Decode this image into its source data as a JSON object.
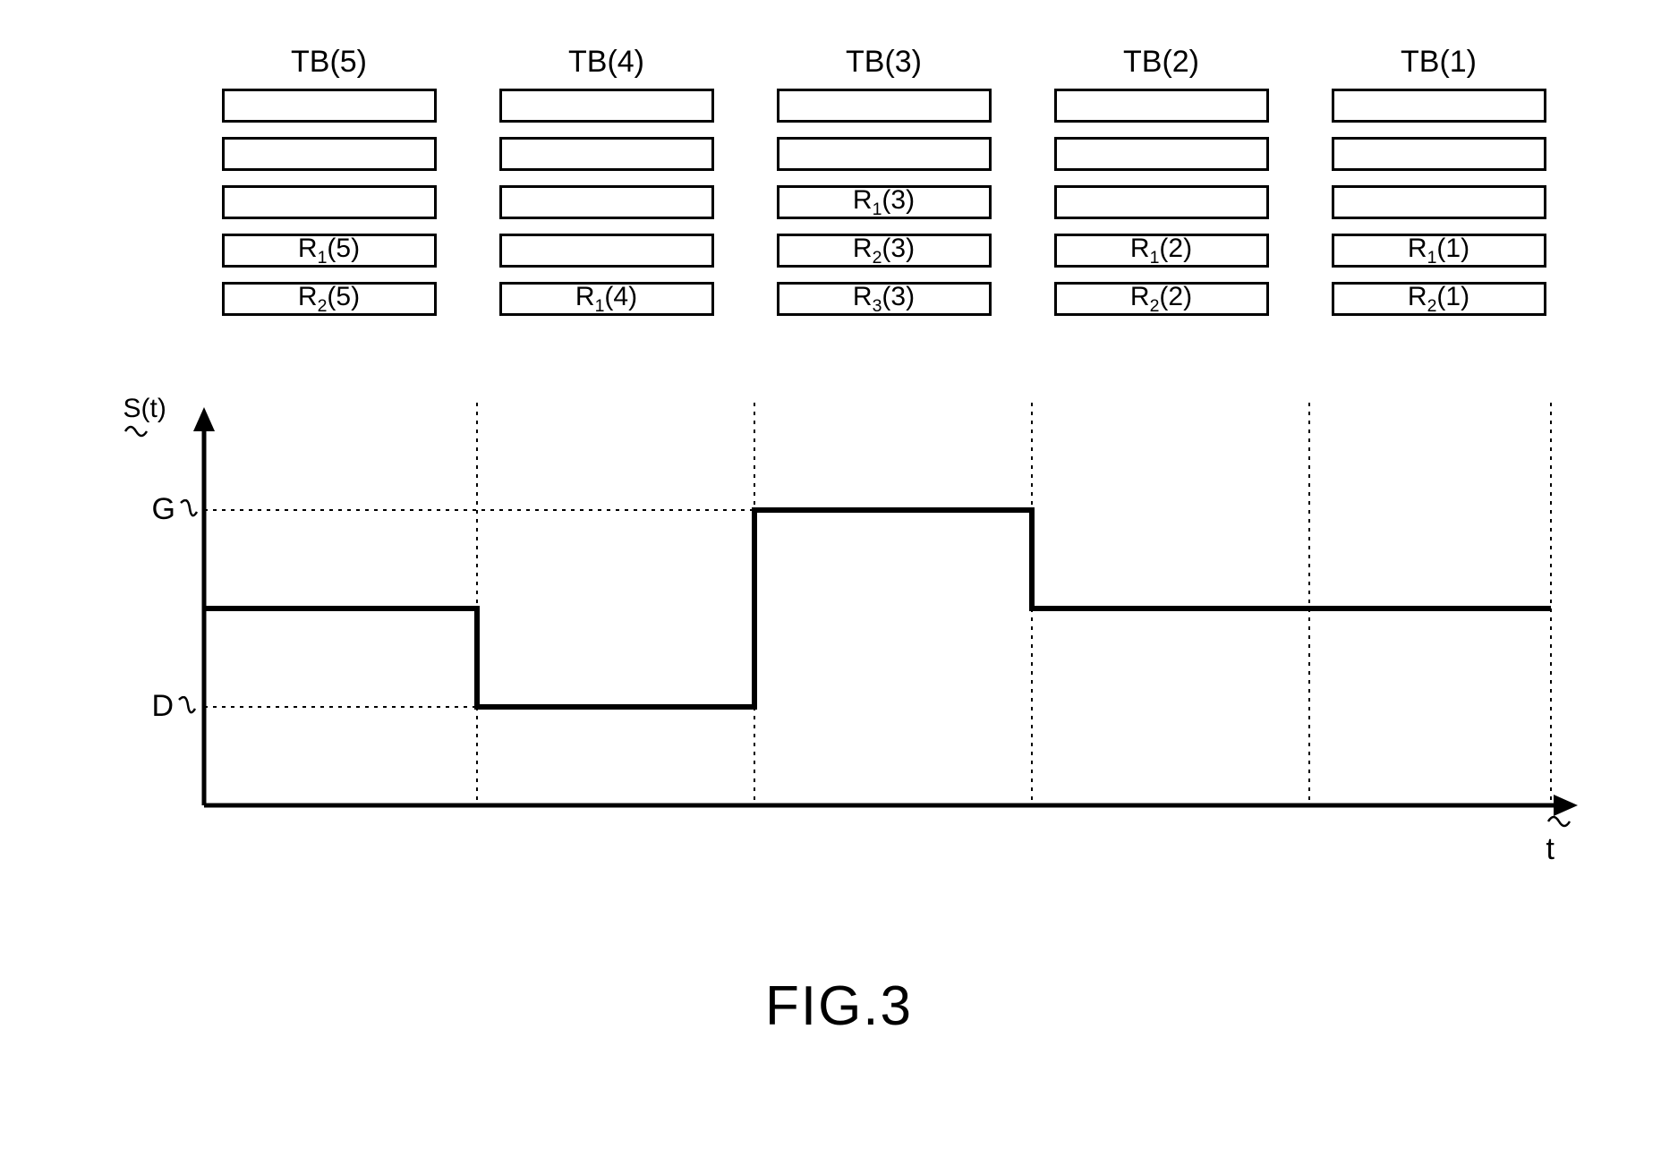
{
  "figure_label": "FIG.3",
  "columns": [
    {
      "label": "TB(5)",
      "bars": [
        "",
        "",
        "",
        "R₁(5)",
        "R₂(5)"
      ]
    },
    {
      "label": "TB(4)",
      "bars": [
        "",
        "",
        "",
        "",
        "R₁(4)"
      ]
    },
    {
      "label": "TB(3)",
      "bars": [
        "",
        "",
        "R₁(3)",
        "R₂(3)",
        "R₃(3)"
      ]
    },
    {
      "label": "TB(2)",
      "bars": [
        "",
        "",
        "",
        "R₁(2)",
        "R₂(2)"
      ]
    },
    {
      "label": "TB(1)",
      "bars": [
        "",
        "",
        "",
        "R₁(1)",
        "R₂(1)"
      ]
    }
  ],
  "axis": {
    "y_label": "S(t)",
    "x_label": "t",
    "y_ticks": [
      "G",
      "D"
    ]
  },
  "chart_data": {
    "type": "bar",
    "title": "FIG.3",
    "xlabel": "t",
    "ylabel": "S(t)",
    "categories": [
      "TB(5)",
      "TB(4)",
      "TB(3)",
      "TB(2)",
      "TB(1)"
    ],
    "values": [
      2,
      1,
      3,
      2,
      2
    ],
    "y_reference_levels": {
      "D": 1,
      "G": 3
    },
    "ylim": [
      0,
      3.5
    ],
    "description": "Step function S(t) over 5 time buckets corresponding to number of R entries in each TB column"
  }
}
